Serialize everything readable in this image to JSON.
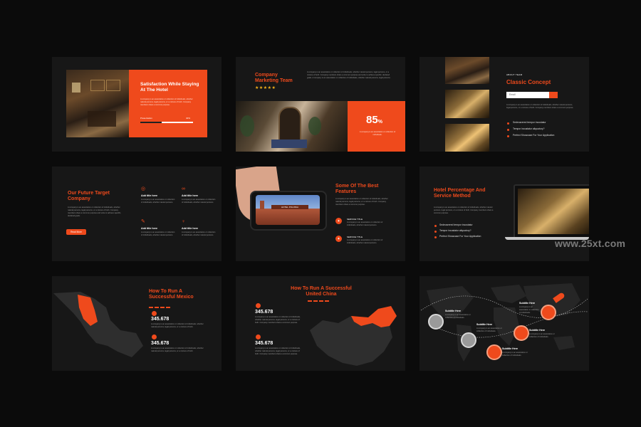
{
  "watermark": "www.25xt.com",
  "colors": {
    "accent": "#ef4a1c",
    "background": "#0b0b0b",
    "slide": "#171717"
  },
  "slide1": {
    "title": "Satisfaction While Staying At The Hotel",
    "body": "A company is an association or collection of individuals, whether natural persons, legal persons, or a mixture of both. Company members share a common purpose.",
    "bar_label": "Presentation",
    "bar_value": "40%",
    "bar_fraction": 0.4
  },
  "slide2": {
    "title": "Company Marketing Team",
    "stars": "★★★★★",
    "body": "A company is an association or collection of individuals, whether natural persons, legal persons, or a mixture of both. Company members share a common purpose and unite to achieve specific, declared goals. A company is an association or collection of individuals, whether natural persons, legal persons.",
    "percent_number": "85",
    "percent_sign": "%",
    "percent_caption": "A company is an association or collection of individuals."
  },
  "slide3": {
    "kicker": "ABOUT TEAM",
    "title": "Classic Concept",
    "email_placeholder": "Email",
    "body": "A company is an association or collection of individuals, whether natural persons, legal persons, or a mixture of both. Company members share a common purpose.",
    "bullets": [
      "Sedeusrered tempor incustatur",
      "Tempor incustatur aliquatory?",
      "Perfect Showcase For Your Application"
    ]
  },
  "slide4": {
    "title": "Our Future Target Company",
    "body": "A company is an association or collection of individuals, whether natural persons, legal persons, or a mixture of both. Company members share a common purpose and unite to achieve specific, declared goals.",
    "button": "Read More",
    "items": [
      {
        "title": "Add title here",
        "body": "A company is an association or collection of individuals, whether natural persons."
      },
      {
        "title": "Add title here",
        "body": "A company is an association or collection of individuals, whether natural persons."
      },
      {
        "title": "Add title here",
        "body": "A company is an association or collection of individuals, whether natural persons."
      },
      {
        "title": "Add title here",
        "body": "A company is an association or collection of individuals, whether natural persons."
      }
    ]
  },
  "slide5": {
    "title": "Some Of The Best Features",
    "body": "A company is an association or collection of individuals, whether natural persons, legal persons, or a mixture of both. Company members share a common purpose.",
    "phone_sign": "HOTEL POLONIA",
    "services": [
      {
        "title": "SERVICE TITLE",
        "body": "A company is an association or collection of individuals, whether natural persons."
      },
      {
        "title": "SERVICE TITLE",
        "body": "A company is an association or collection of individuals, whether natural persons."
      }
    ]
  },
  "slide6": {
    "title": "Hotel Percentage And Service Method",
    "body": "A company is an association or collection of individuals, whether natural persons, legal persons, or a mixture of both. Company members share a common purpose.",
    "bullets": [
      "Sedeusrered tempor incustatur",
      "Tempor incustatur aliquatory?",
      "Perfect Showcase For Your Application"
    ]
  },
  "slide7": {
    "title": "How To Run A Successful Mexico",
    "stats": [
      {
        "value": "345.678",
        "body": "A company is an association or collection of individuals, whether natural persons, legal persons, or a mixture of both."
      },
      {
        "value": "345.678",
        "body": "A company is an association or collection of individuals, whether natural persons, legal persons, or a mixture of both."
      }
    ]
  },
  "slide8": {
    "title": "How To Run A Successful United China",
    "stats": [
      {
        "value": "345.678",
        "body": "A company is an association or collection of individuals, whether natural persons, legal persons, or a mixture of both. Company members share a common purpose."
      },
      {
        "value": "345.678",
        "body": "A company is an association or collection of individuals, whether natural persons, legal persons, or a mixture of both. Company members share a common purpose."
      }
    ]
  },
  "slide9": {
    "labels": [
      {
        "title": "Subtitle Here",
        "body": "A company is an association or collection of individuals."
      },
      {
        "title": "Subtitle Here",
        "body": "A company is an association or collection of individuals."
      },
      {
        "title": "Subtitle Here",
        "body": "A company is an association or collection of individuals."
      },
      {
        "title": "Subtitle Here",
        "body": "A company is an association or collection of individuals."
      },
      {
        "title": "Subtitle Here",
        "body": "A company is an association or collection of individuals."
      }
    ]
  }
}
